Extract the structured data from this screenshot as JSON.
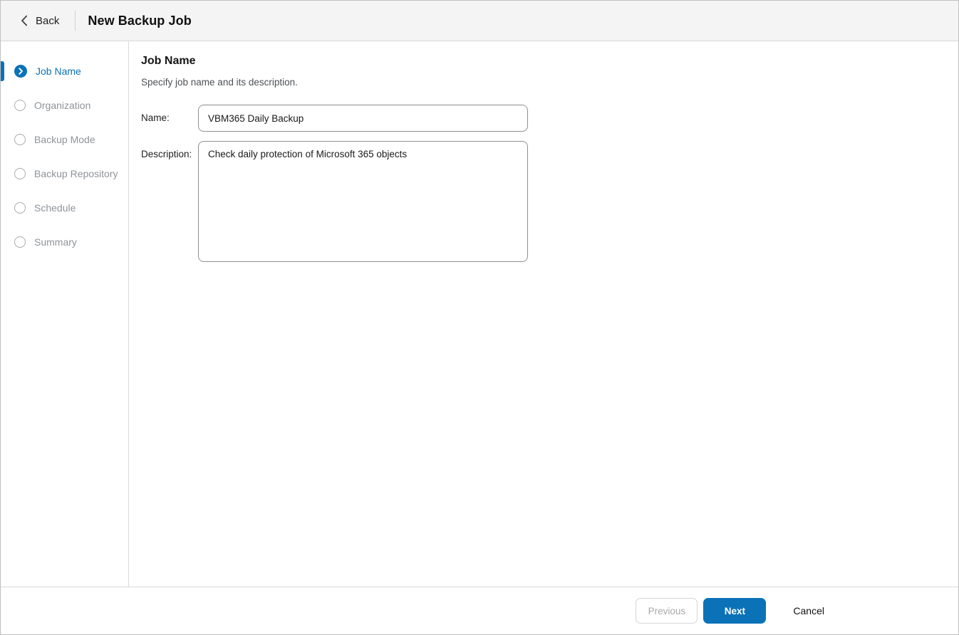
{
  "header": {
    "back_label": "Back",
    "title": "New Backup Job"
  },
  "sidebar": {
    "steps": [
      {
        "label": "Job Name",
        "state": "active"
      },
      {
        "label": "Organization",
        "state": "pending"
      },
      {
        "label": "Backup Mode",
        "state": "pending"
      },
      {
        "label": "Backup Repository",
        "state": "pending"
      },
      {
        "label": "Schedule",
        "state": "pending"
      },
      {
        "label": "Summary",
        "state": "pending"
      }
    ]
  },
  "main": {
    "heading": "Job Name",
    "subtitle": "Specify job name and its description.",
    "fields": {
      "name_label": "Name:",
      "name_value": "VBM365 Daily Backup",
      "description_label": "Description:",
      "description_value": "Check daily protection of Microsoft 365 objects"
    }
  },
  "footer": {
    "previous_label": "Previous",
    "next_label": "Next",
    "cancel_label": "Cancel"
  },
  "colors": {
    "accent_blue": "#0b72b8",
    "inactive_gray": "#8f9499",
    "header_bg": "#f4f4f4",
    "border_gray": "#d9d9d9"
  }
}
